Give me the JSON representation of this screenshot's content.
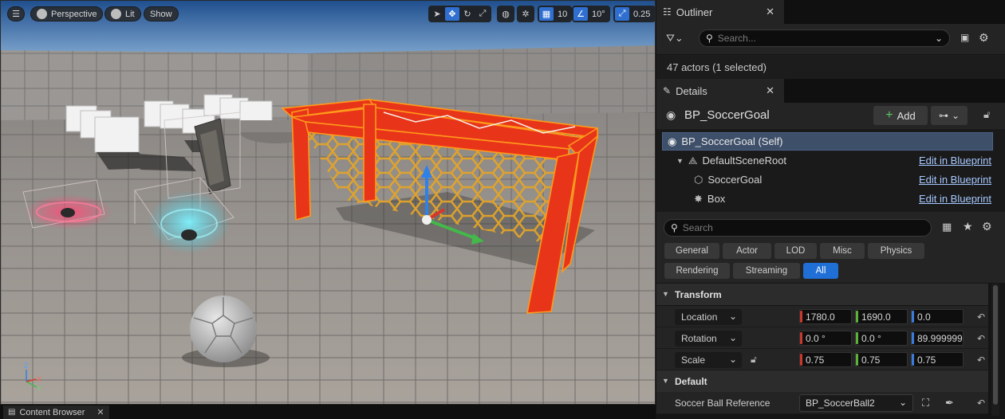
{
  "viewport": {
    "view_mode": "Perspective",
    "lit_label": "Lit",
    "show_label": "Show",
    "grid_snap": "10",
    "rotation_snap": "10°",
    "scale_snap": "0.25"
  },
  "statusbar": {
    "content_browser_tab": "Content Browser"
  },
  "outliner": {
    "tab_title": "Outliner",
    "search_placeholder": "Search...",
    "status": "47 actors (1 selected)"
  },
  "details": {
    "tab_title": "Details",
    "actor_name": "BP_SoccerGoal",
    "add_label": "Add",
    "components": [
      {
        "label": "BP_SoccerGoal (Self)",
        "link": ""
      },
      {
        "label": "DefaultSceneRoot",
        "link": "Edit in Blueprint"
      },
      {
        "label": "SoccerGoal",
        "link": "Edit in Blueprint"
      },
      {
        "label": "Box",
        "link": "Edit in Blueprint"
      }
    ],
    "search_placeholder": "Search",
    "categories": [
      "General",
      "Actor",
      "LOD",
      "Misc",
      "Physics",
      "Rendering",
      "Streaming",
      "All"
    ],
    "active_category": "All",
    "transform": {
      "header": "Transform",
      "location": {
        "label": "Location",
        "x": "1780.0",
        "y": "1690.0",
        "z": "0.0"
      },
      "rotation": {
        "label": "Rotation",
        "x": "0.0 °",
        "y": "0.0 °",
        "z": "89.999999"
      },
      "scale": {
        "label": "Scale",
        "x": "0.75",
        "y": "0.75",
        "z": "0.75"
      }
    },
    "default_group": {
      "header": "Default",
      "soccer_ball_reference_label": "Soccer Ball Reference",
      "soccer_ball_reference_value": "BP_SoccerBall2"
    }
  },
  "colors": {
    "accent": "#1f6fd6",
    "goal_frame": "#e8351a",
    "goal_net": "#e0a020",
    "selection_outline": "#ff9a1a"
  }
}
